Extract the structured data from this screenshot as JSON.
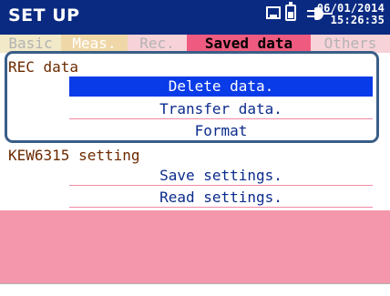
{
  "header": {
    "title": "SET UP",
    "date": "06/01/2014",
    "time": "15:26:35",
    "icons": [
      "sd-card-icon",
      "battery-icon",
      "power-plug-icon"
    ]
  },
  "tabs": [
    {
      "label": "Basic",
      "state": "inactive"
    },
    {
      "label": "Meas.",
      "state": "inactive"
    },
    {
      "label": "Rec.",
      "state": "inactive"
    },
    {
      "label": "Saved data",
      "state": "active"
    },
    {
      "label": "Others",
      "state": "inactive"
    }
  ],
  "rec_data": {
    "label": "REC data",
    "items": [
      {
        "label": "Delete data.",
        "selected": true
      },
      {
        "label": "Transfer data.",
        "selected": false
      },
      {
        "label": "Format",
        "selected": false
      }
    ]
  },
  "device_setting": {
    "label": "KEW6315 setting",
    "items": [
      {
        "label": "Save settings."
      },
      {
        "label": "Read settings."
      }
    ]
  },
  "colors": {
    "titlebar": "#0a2a82",
    "active_tab": "#ef5b80",
    "selection": "#0a3be8",
    "frame": "#3a5e88",
    "band": "#f497ad"
  }
}
